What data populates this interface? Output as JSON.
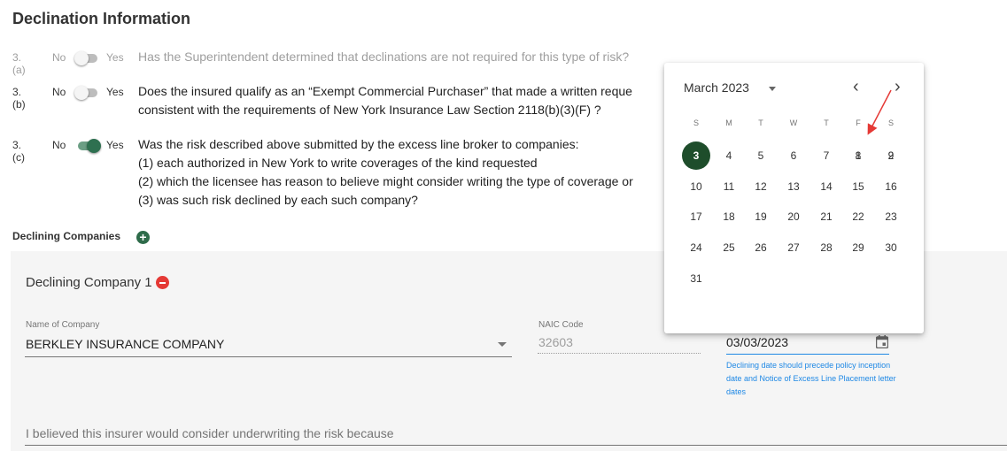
{
  "section_title": "Declination Information",
  "questions": [
    {
      "num": "3. (a)",
      "no": "No",
      "yes": "Yes",
      "lines": [
        "Has the Superintendent determined that declinations are not required for this type of risk?"
      ],
      "state": "off",
      "disabled": true
    },
    {
      "num": "3. (b)",
      "no": "No",
      "yes": "Yes",
      "lines": [
        "Does the insured qualify as an “Exempt Commercial Purchaser” that made a written reque",
        "consistent with the requirements of New York Insurance Law Section 2118(b)(3)(F) ?"
      ],
      "state": "off",
      "disabled": false
    },
    {
      "num": "3. (c)",
      "no": "No",
      "yes": "Yes",
      "lines": [
        "Was the risk described above submitted by the excess line broker to companies:",
        "(1) each authorized in New York to write coverages of the kind requested",
        "(2) which the licensee has reason to believe might consider writing the type of coverage or",
        "(3) was such risk declined by each such company?"
      ],
      "state": "on",
      "disabled": false
    }
  ],
  "declining": {
    "header": "Declining Companies",
    "add_symbol": "+",
    "company_title": "Declining Company 1",
    "name_label": "Name of Company",
    "name_value": "BERKLEY INSURANCE COMPANY",
    "naic_label": "NAIC Code",
    "naic_value": "32603",
    "date_value": "03/03/2023",
    "date_hint": "Declining date should precede policy inception date and Notice of Excess Line Placement letter dates",
    "reason_placeholder": "I believed this insurer would consider underwriting the risk because"
  },
  "calendar": {
    "month_label": "March 2023",
    "prev": "‹",
    "next": "›",
    "weekdays": [
      "S",
      "M",
      "T",
      "W",
      "T",
      "F",
      "S"
    ],
    "first_weekday_index": 3,
    "days_in_month": 31,
    "selected_day": 3
  },
  "colors": {
    "accent": "#2e6b4a",
    "selected": "#1e4d2b",
    "remove": "#e53935",
    "hint": "#1e88e5",
    "arrow": "#e53935"
  }
}
